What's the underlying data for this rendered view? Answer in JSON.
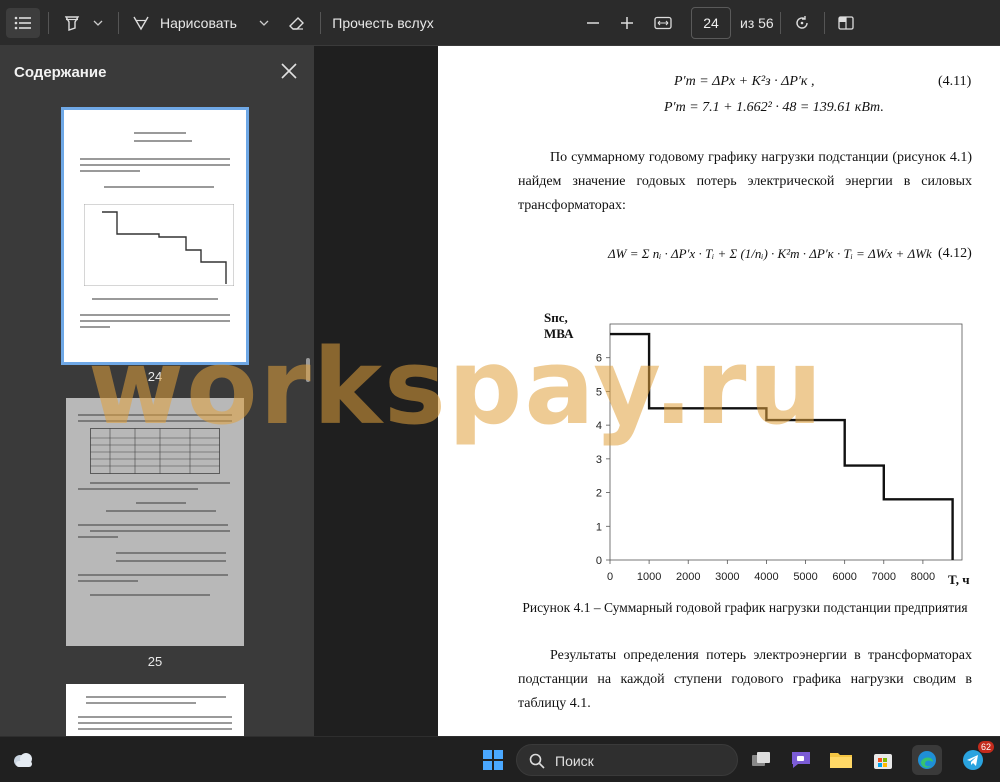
{
  "toolbar": {
    "draw_label": "Нарисовать",
    "read_aloud_label": "Прочесть вслух",
    "page_number": "24",
    "page_total": "из 56"
  },
  "sidebar": {
    "title": "Содержание",
    "thumbnails": [
      {
        "page": "24",
        "selected": true
      },
      {
        "page": "25",
        "selected": false
      }
    ]
  },
  "document": {
    "formula_4_11_line1": "P′m = ΔPx + K²з · ΔP′к ,",
    "formula_4_11_num": "(4.11)",
    "formula_4_11_line2": "P′m = 7.1 + 1.662² · 48 = 139.61 кВт.",
    "para1": "По суммарному годовому графику нагрузки подстанции (рисунок 4.1) найдем значение годовых потерь электрической энергии в силовых трансформаторах:",
    "formula_4_12": "ΔW = Σ nᵢ · ΔP′x · Tᵢ + Σ (1/nᵢ) · K²m · ΔP′к · Tᵢ = ΔWx + ΔWk",
    "formula_4_12_num": "(4.12)",
    "caption": "Рисунок 4.1 – Суммарный годовой график нагрузки подстанции предприятия",
    "para2": "Результаты определения потерь электроэнергии в трансформаторах подстанции на каждой ступени годового графика нагрузки сводим в таблицу 4.1."
  },
  "chart_data": {
    "type": "line",
    "ylabel": "Sпс, МВА",
    "xlabel": "T, ч",
    "xlim": [
      0,
      9000
    ],
    "ylim": [
      0,
      7
    ],
    "x_ticks": [
      "0",
      "1000",
      "2000",
      "3000",
      "4000",
      "5000",
      "6000",
      "7000",
      "8000"
    ],
    "y_ticks": [
      "0",
      "1",
      "2",
      "3",
      "4",
      "5",
      "6"
    ],
    "step_points": [
      [
        0,
        6.7
      ],
      [
        1000,
        6.7
      ],
      [
        1000,
        4.5
      ],
      [
        4000,
        4.5
      ],
      [
        4000,
        4.15
      ],
      [
        6000,
        4.15
      ],
      [
        6000,
        2.8
      ],
      [
        7000,
        2.8
      ],
      [
        7000,
        1.8
      ],
      [
        8760,
        1.8
      ],
      [
        8760,
        0
      ]
    ]
  },
  "watermark": "workspay.ru",
  "taskbar": {
    "search_label": "Поиск",
    "telegram_badge": "62"
  }
}
